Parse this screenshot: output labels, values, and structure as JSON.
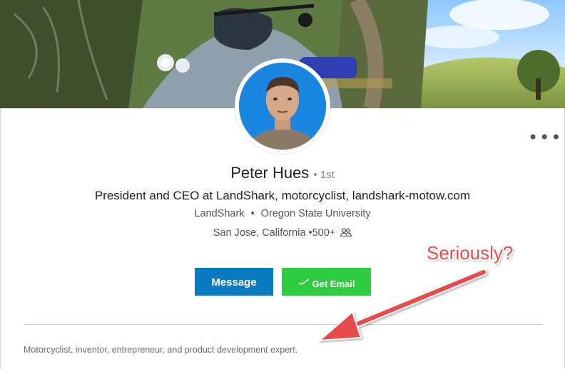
{
  "profile": {
    "name": "Peter Hues",
    "degree": "• 1st",
    "headline": "President and CEO at LandShark, motorcyclist, landshark-motow.com",
    "company": "LandShark",
    "separator": "•",
    "school": "Oregon State University",
    "location": "San Jose, California",
    "connections": "•500+",
    "summary": "Motorcyclist, inventor, entrepreneur, and product development expert."
  },
  "actions": {
    "message_label": "Message",
    "get_email_label": "Get Email",
    "more_label": "•••"
  },
  "annotation": {
    "text": "Seriously?",
    "color": "#e84b4b"
  },
  "colors": {
    "message_button": "#0b7bc1",
    "get_email_button": "#2ecc40"
  },
  "icons": {
    "connections": "people-icon",
    "more": "more-horizontal-icon",
    "email_extension": "checkmark-swoosh-icon"
  }
}
